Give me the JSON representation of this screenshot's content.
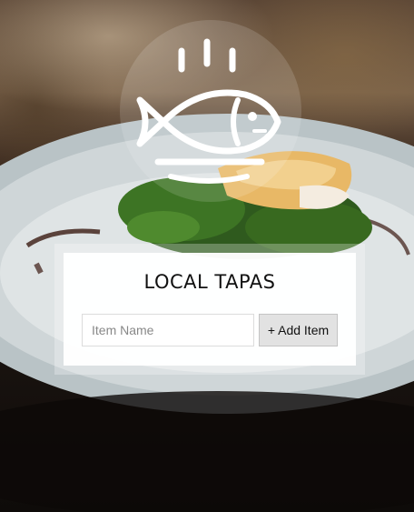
{
  "app": {
    "title": "LOCAL TAPAS"
  },
  "logo": {
    "icon": "fish-on-plate-icon",
    "steam_icon": "steam-lines-icon"
  },
  "form": {
    "item_input": {
      "placeholder": "Item Name",
      "value": ""
    },
    "add_button": {
      "label": "+ Add Item"
    }
  },
  "colors": {
    "card_background": "#ffffff",
    "button_background": "#e2e2e2",
    "title_text": "#111111",
    "logo_stroke": "#ffffff"
  }
}
